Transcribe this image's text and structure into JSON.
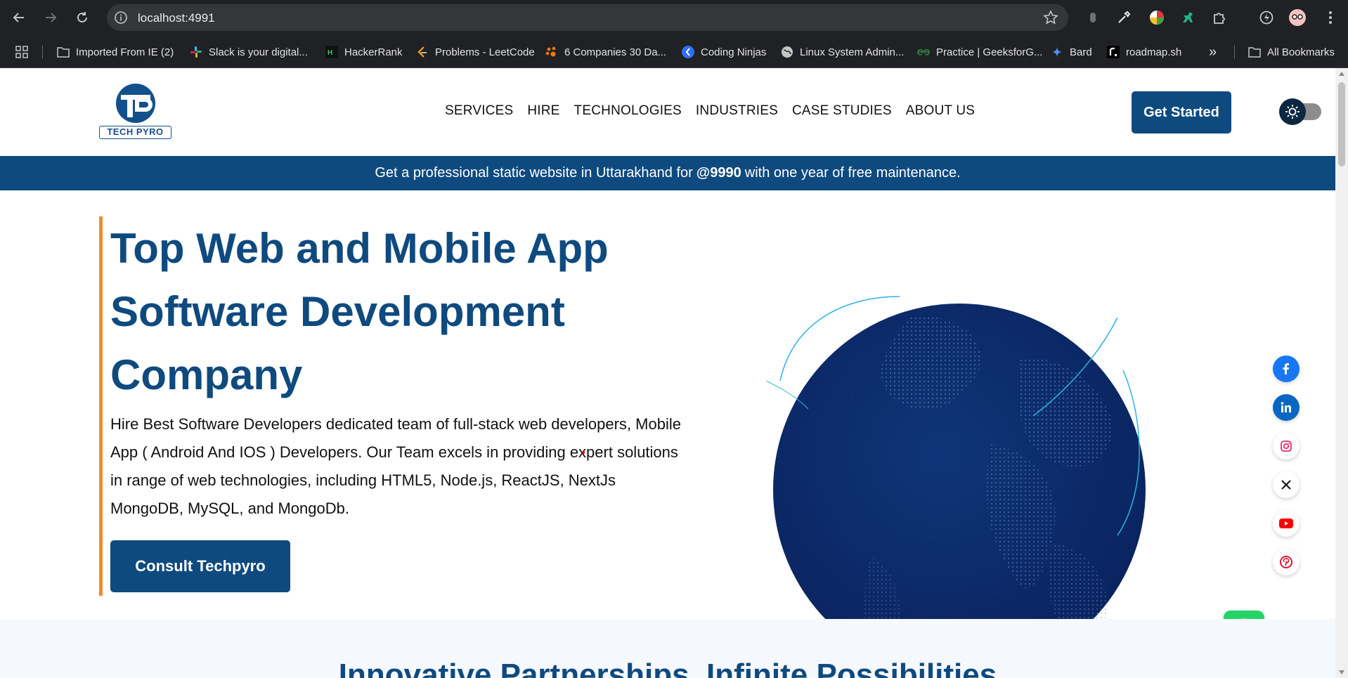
{
  "browser": {
    "url": "localhost:4991",
    "bookmarks": [
      {
        "label": "Imported From IE (2)",
        "icon": "folder-icon"
      },
      {
        "label": "Slack is your digital...",
        "icon": "slack-icon"
      },
      {
        "label": "HackerRank",
        "icon": "hackerrank-icon"
      },
      {
        "label": "Problems - LeetCode",
        "icon": "leetcode-icon"
      },
      {
        "label": "6 Companies 30 Da...",
        "icon": "paw-icon"
      },
      {
        "label": "Coding Ninjas",
        "icon": "coding-ninjas-icon"
      },
      {
        "label": "Linux System Admin...",
        "icon": "globe-icon"
      },
      {
        "label": "Practice | GeeksforG...",
        "icon": "geeksforgeeks-icon"
      },
      {
        "label": "Bard",
        "icon": "bard-icon"
      },
      {
        "label": "roadmap.sh",
        "icon": "roadmap-icon"
      }
    ],
    "more_glyph": "»",
    "all_bookmarks": "All Bookmarks"
  },
  "site": {
    "logo_text": "TECH PYRO",
    "nav": [
      "SERVICES",
      "HIRE",
      "TECHNOLOGIES",
      "INDUSTRIES",
      "CASE STUDIES",
      "ABOUT US"
    ],
    "cta": "Get Started",
    "promo": {
      "before": "Get a professional static website in Uttarakhand for",
      "price": "@9990",
      "after": "with one year of free maintenance."
    },
    "hero": {
      "title_lines": [
        "Top Web and Mobile App",
        "Software Development",
        "Company"
      ],
      "description": "Hire Best Software Developers dedicated team of full-stack web developers, Mobile App ( Android And IOS ) Developers. Our Team excels in providing expert solutions in range of web technologies, including HTML5, Node.js, ReactJS, NextJs MongoDB, MySQL, and MongoDb.",
      "button": "Consult Techpyro"
    },
    "social": [
      "facebook-icon",
      "linkedin-icon",
      "instagram-icon",
      "x-icon",
      "youtube-icon",
      "pinterest-icon"
    ],
    "next_section_title": "Innovative Partnerships, Infinite Possibilities"
  },
  "colors": {
    "brand_blue": "#0f4a7f",
    "accent_orange": "#f28c28",
    "whatsapp_green": "#25d366"
  }
}
